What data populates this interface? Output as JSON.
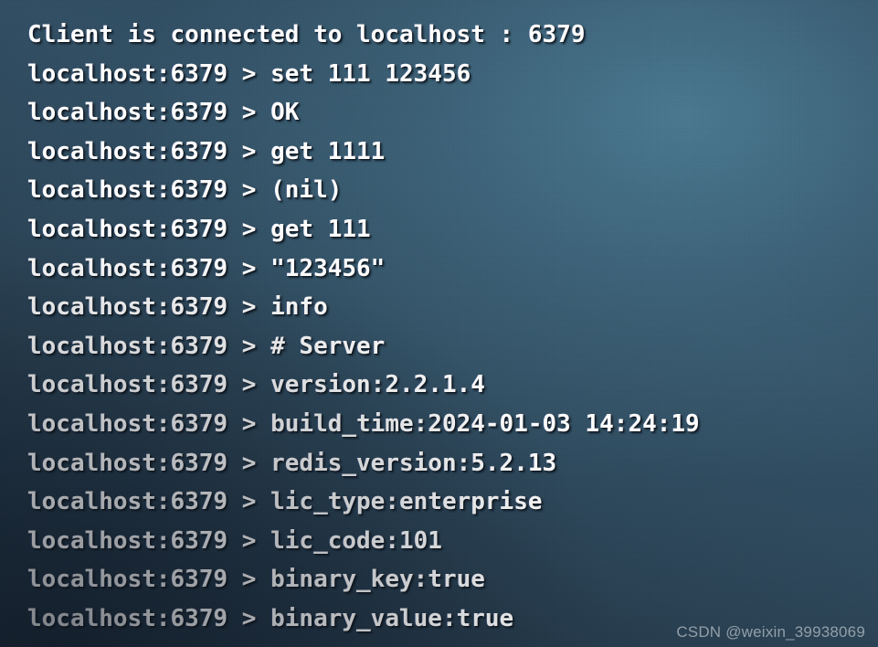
{
  "terminal": {
    "connection_host": "localhost",
    "connection_port": "6379",
    "prompt": "localhost:6379 >",
    "lines": [
      {
        "text": "Client is connected to localhost : 6379"
      },
      {
        "text": "localhost:6379 > set 111 123456"
      },
      {
        "text": "localhost:6379 > OK"
      },
      {
        "text": "localhost:6379 > get 1111"
      },
      {
        "text": "localhost:6379 > (nil)"
      },
      {
        "text": "localhost:6379 > get 111"
      },
      {
        "text": "localhost:6379 > \"123456\""
      },
      {
        "text": "localhost:6379 > info"
      },
      {
        "text": "localhost:6379 > # Server"
      },
      {
        "text": "localhost:6379 > version:2.2.1.4"
      },
      {
        "text": "localhost:6379 > build_time:2024-01-03 14:24:19"
      },
      {
        "text": "localhost:6379 > redis_version:5.2.13"
      },
      {
        "text": "localhost:6379 > lic_type:enterprise"
      },
      {
        "text": "localhost:6379 > lic_code:101"
      },
      {
        "text": "localhost:6379 > binary_key:true"
      },
      {
        "text": "localhost:6379 > binary_value:true"
      }
    ],
    "server_info": {
      "section": "# Server",
      "version": "2.2.1.4",
      "build_time": "2024-01-03 14:24:19",
      "redis_version": "5.2.13",
      "lic_type": "enterprise",
      "lic_code": "101",
      "binary_key": "true",
      "binary_value": "true"
    },
    "colors": {
      "text": "#fdfdfd",
      "background_light": "#3d6378",
      "background_dark": "#1e2b3a",
      "watermark": "#9aa7b0"
    }
  },
  "watermark": {
    "text": "CSDN @weixin_39938069"
  }
}
